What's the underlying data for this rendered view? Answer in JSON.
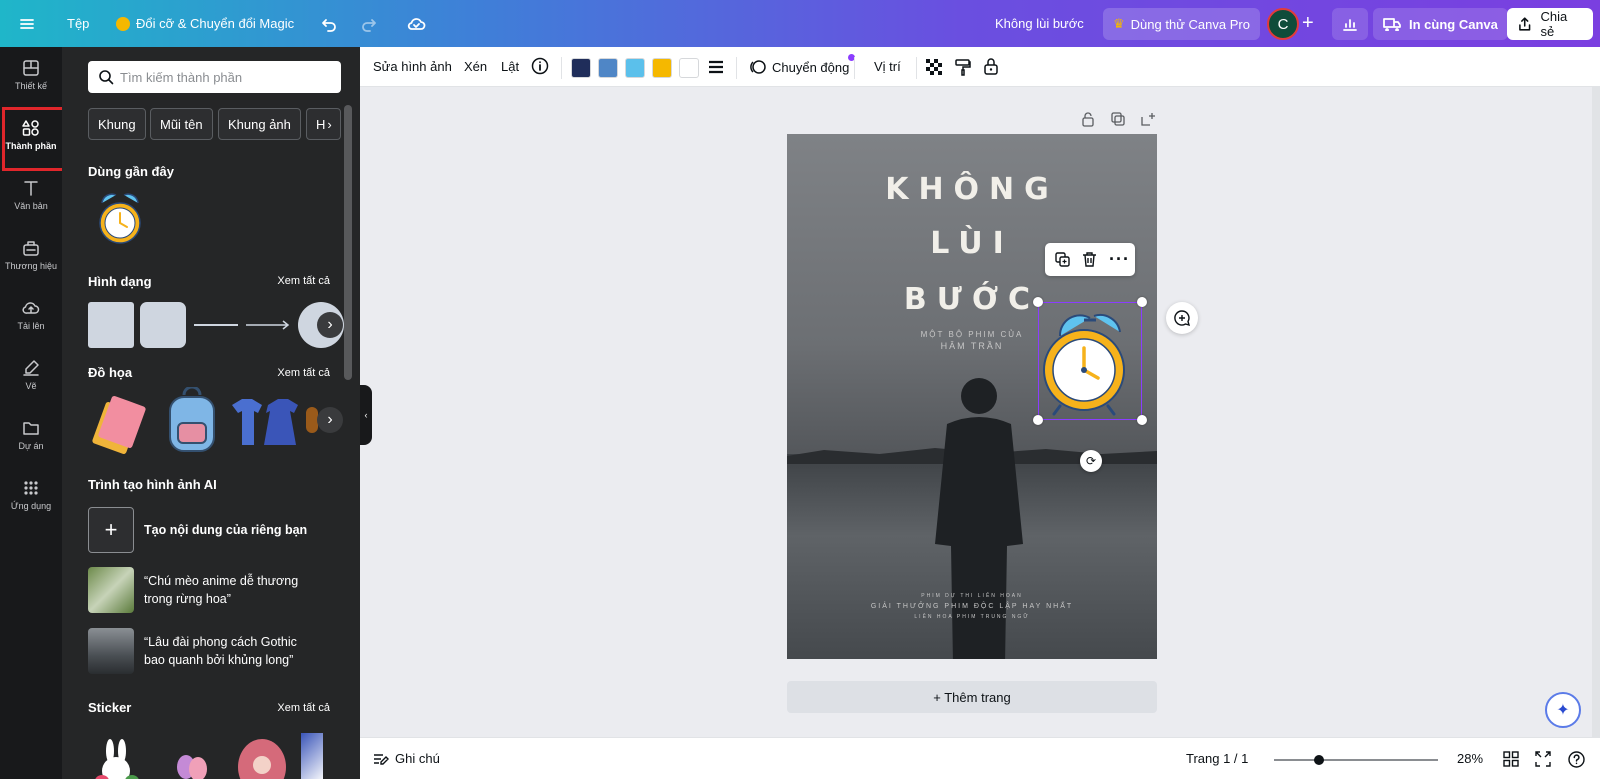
{
  "topbar": {
    "file_label": "Tệp",
    "magic_label": "Đổi cỡ & Chuyển đổi Magic",
    "doc_title": "Không lùi bước",
    "pro_label": "Dùng thử Canva Pro",
    "avatar_initial": "C",
    "print_label": "In cùng Canva",
    "share_label": "Chia sẻ"
  },
  "rail": {
    "items": [
      {
        "label": "Thiết kế",
        "icon": "layout-icon"
      },
      {
        "label": "Thành phần",
        "icon": "elements-icon"
      },
      {
        "label": "Văn bản",
        "icon": "text-icon"
      },
      {
        "label": "Thương hiệu",
        "icon": "brand-icon"
      },
      {
        "label": "Tải lên",
        "icon": "upload-icon"
      },
      {
        "label": "Vẽ",
        "icon": "draw-icon"
      },
      {
        "label": "Dự án",
        "icon": "folder-icon"
      },
      {
        "label": "Ứng dụng",
        "icon": "apps-icon"
      }
    ]
  },
  "panel": {
    "search_placeholder": "Tìm kiếm thành phần",
    "chips": [
      "Khung",
      "Mũi tên",
      "Khung ảnh",
      "H"
    ],
    "recent_title": "Dùng gần đây",
    "shapes_title": "Hình dạng",
    "graphics_title": "Đồ họa",
    "ai_title": "Trình tạo hình ảnh AI",
    "sticker_title": "Sticker",
    "see_all": "Xem tất cả",
    "ai_items": [
      "Tạo nội dung của riêng bạn",
      "“Chú mèo anime dễ thương trong rừng hoa”",
      "“Lâu đài phong cách Gothic bao quanh bởi khủng long”"
    ]
  },
  "toolbar": {
    "edit_image": "Sửa hình ảnh",
    "crop": "Xén",
    "flip": "Lật",
    "animate": "Chuyển động",
    "position": "Vị trí",
    "swatches": [
      "#1f2d5a",
      "#4f86c6",
      "#5bc0eb",
      "#f5b800",
      "#ffffff"
    ]
  },
  "page": {
    "title_line1": "KHÔNG",
    "title_line2": "LÙI",
    "title_line3": "BƯỚC",
    "subtitle1": "MỘT BỘ PHIM CỦA",
    "subtitle2": "HÂM TRẦN",
    "award1": "PHIM DỰ THI LIÊN HOAN",
    "award2": "GIẢI THƯỞNG PHIM ĐỘC LẬP HAY NHẤT",
    "award3": "LIÊN HOA PHIM TRUNG NGỮ"
  },
  "add_page_label": "+ Thêm trang",
  "bottombar": {
    "notes": "Ghi chú",
    "page_indicator": "Trang 1 / 1",
    "zoom": "28%"
  },
  "colors": {
    "accent": "#8b3dff",
    "highlight": "#e0262b"
  }
}
